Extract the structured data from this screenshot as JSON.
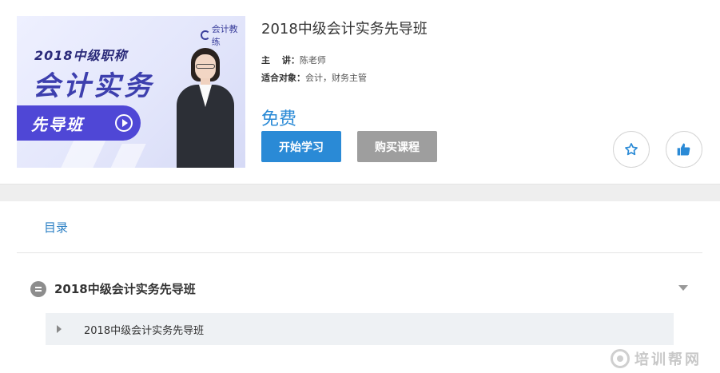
{
  "course": {
    "cover": {
      "logo_text": "会计教练",
      "subtitle": "2018中级职称",
      "title": "会计实务",
      "badge": "先导班"
    },
    "title": "2018中级会计实务先导班",
    "teacher_label": "主　 讲：",
    "teacher": "陈老师",
    "audience_label": "适合对象：",
    "audience": "会计，财务主管",
    "price": "免费",
    "start_button": "开始学习",
    "buy_button": "购买课程"
  },
  "icons": {
    "favorite": "star-icon",
    "like": "thumbs-up-icon",
    "accent": "#2a8ad6"
  },
  "catalog": {
    "tab_label": "目录",
    "chapter": "2018中级会计实务先导班",
    "lessons": [
      "2018中级会计实务先导班"
    ]
  },
  "watermark": {
    "text": "培训帮网"
  }
}
